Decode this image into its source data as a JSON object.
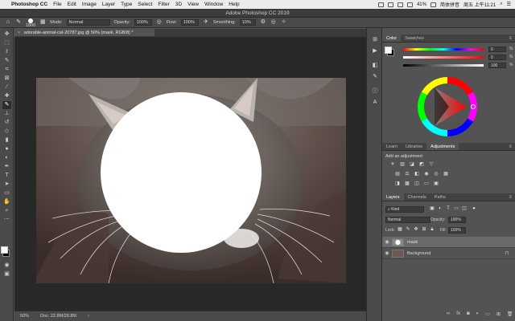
{
  "menubar": {
    "app": "Photoshop CC",
    "items": [
      "File",
      "Edit",
      "Image",
      "Layer",
      "Type",
      "Select",
      "Filter",
      "3D",
      "View",
      "Window",
      "Help"
    ],
    "battery": "41%",
    "input_method": "简体拼音",
    "clock": "周五 上午11:21"
  },
  "window_title": "Adobe Photoshop CC 2019",
  "options": {
    "brush_size": "1800",
    "mode_label": "Mode:",
    "mode_value": "Normal",
    "opacity_label": "Opacity:",
    "opacity_value": "100%",
    "flow_label": "Flow:",
    "flow_value": "100%",
    "smoothing_label": "Smoothing:",
    "smoothing_value": "10%"
  },
  "document": {
    "tab_title": "adorable-animal-cat-20787.jpg @ 50% (mask, RGB/8) *",
    "close_glyph": "×",
    "zoom": "50%",
    "doc_info": "Doc: 22.8M/28.8M"
  },
  "color_panel": {
    "tabs": [
      "Color",
      "Swatches"
    ],
    "sliders": [
      {
        "value": "0",
        "unit": "%"
      },
      {
        "value": "0",
        "unit": "%"
      },
      {
        "value": "100",
        "unit": "%"
      }
    ]
  },
  "adjustments_panel": {
    "tabs": [
      "Learn",
      "Libraries",
      "Adjustments"
    ],
    "heading": "Add an adjustment"
  },
  "layers_panel": {
    "tabs": [
      "Layers",
      "Channels",
      "Paths"
    ],
    "filter_value": "Kind",
    "blend_mode": "Normal",
    "opacity_label": "Opacity:",
    "opacity_value": "100%",
    "lock_label": "Lock:",
    "fill_label": "Fill:",
    "fill_value": "100%",
    "layers": [
      {
        "name": "mask",
        "selected": true
      },
      {
        "name": "Background",
        "selected": false
      }
    ]
  },
  "colors": {
    "foreground": "#ffffff",
    "background": "#000000",
    "accent": "#e12020"
  }
}
